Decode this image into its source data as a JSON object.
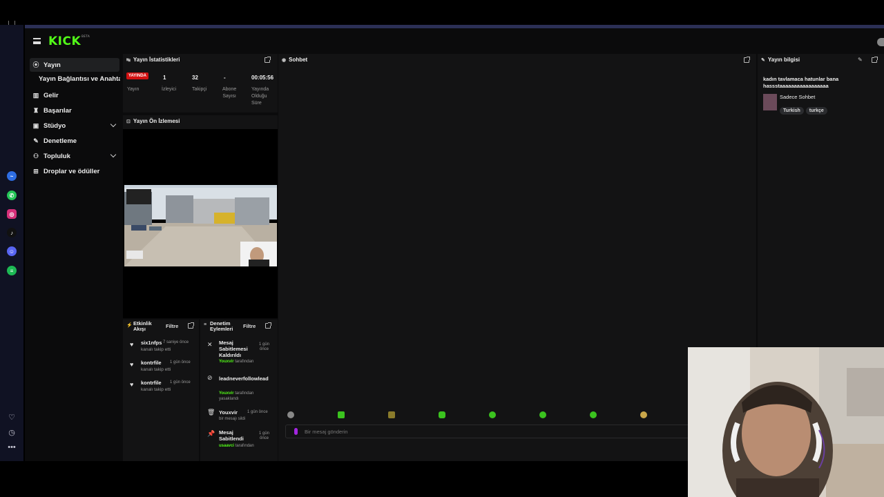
{
  "brand": {
    "logo": "KICK",
    "beta": "BETA",
    "accent": "#53fc18"
  },
  "sidebar": {
    "items": [
      {
        "label": "Yayın",
        "icon": "broadcast-icon",
        "active": true
      },
      {
        "label": "Yayın Bağlantısı ve Anahtarı",
        "sub": true
      },
      {
        "label": "Gelir",
        "icon": "chart-icon"
      },
      {
        "label": "Başarılar",
        "icon": "trophy-icon"
      },
      {
        "label": "Stüdyo",
        "icon": "studio-icon",
        "expandable": true
      },
      {
        "label": "Denetleme",
        "icon": "wrench-icon"
      },
      {
        "label": "Topluluk",
        "icon": "community-icon",
        "expandable": true
      },
      {
        "label": "Droplar ve ödüller",
        "icon": "gift-icon"
      }
    ]
  },
  "stats": {
    "title": "Yayın İstatistikleri",
    "live_badge": "YAYINDA",
    "viewers": "1",
    "followers": "32",
    "subs": "-",
    "duration": "00:05:56",
    "labels": {
      "stream": "Yayın",
      "viewers": "İzleyici",
      "followers": "Takipçi",
      "subs_1": "Abone",
      "subs_2": "Sayısı",
      "dur_1": "Yayında",
      "dur_2": "Olduğu",
      "dur_3": "Süre"
    }
  },
  "preview": {
    "title": "Yayın Ön İzlemesi"
  },
  "activity": {
    "title_1": "Etkinlik",
    "title_2": "Akışı",
    "filter": "Filtre",
    "items": [
      {
        "name": "six1nfps",
        "time": "7 saniye önce",
        "action": "kanalı takip etti"
      },
      {
        "name": "kontrfile",
        "time": "1 gün önce",
        "action": "kanalı takip etti"
      },
      {
        "name": "kontrfile",
        "time": "1 gün önce",
        "action": "kanalı takip etti"
      }
    ]
  },
  "moderation": {
    "title_1": "Denetim",
    "title_2": "Eylemleri",
    "filter": "Filtre",
    "items": [
      {
        "l1": "Mesaj",
        "l2": "Sabitlemesi",
        "l3": "Kaldırıldı",
        "time_1": "1 gün",
        "time_2": "önce",
        "by": "Youxvir",
        "by_suffix": "tarafından"
      },
      {
        "l1": "leadneverfollowlead",
        "by": "Youxvir",
        "by_suffix": "tarafından",
        "extra": "yasaklandı"
      },
      {
        "l1": "Youxvir",
        "time": "1 gün önce",
        "extra": "bir mesajı sildi"
      },
      {
        "l1": "Mesaj",
        "l2": "Sabitlendi",
        "time_1": "1 gün",
        "time_2": "önce",
        "by": "usaavci",
        "by_suffix": "tarafından"
      }
    ]
  },
  "chat": {
    "title": "Sohbet",
    "placeholder": "Bir mesaj gönderin"
  },
  "info": {
    "title": "Yayın bilgisi",
    "stream_title": "kadın tavlamaca hatunlar bana hassstaaaaaaaaaaaaaaaaa",
    "category": "Sadece Sohbet",
    "tags": [
      "Turkish",
      "turkçe"
    ]
  }
}
